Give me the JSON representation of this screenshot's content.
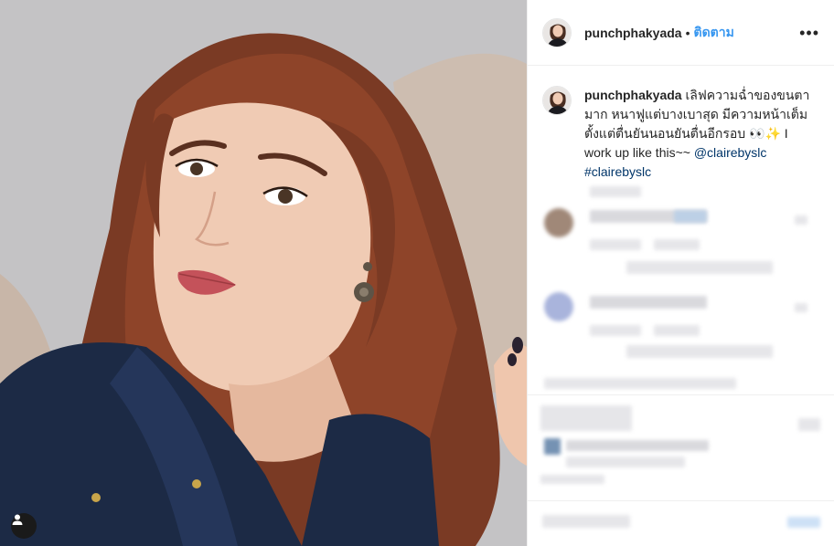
{
  "post": {
    "username": "punchphakyada",
    "separator": "•",
    "follow_label": "ติดตาม",
    "more_label": "•••"
  },
  "caption": {
    "username": "punchphakyada",
    "body": "เลิฟความฉ่ำของขนตามาก หนาฟูแต่บางเบาสุด มีความหน้าเต็มตั้งแต่ตื่นยันนอนยันตื่นอีกรอบ 👀✨ I work up like this~~ ",
    "mention": "@clairebyslc",
    "hashtag": "#clairebyslc"
  },
  "icons": {
    "more": "more-options-icon",
    "tag": "user-tag-icon"
  },
  "colors": {
    "link_blue": "#3897f0",
    "hashtag_dark_blue": "#003569",
    "text": "#262626",
    "border": "#efefef"
  }
}
